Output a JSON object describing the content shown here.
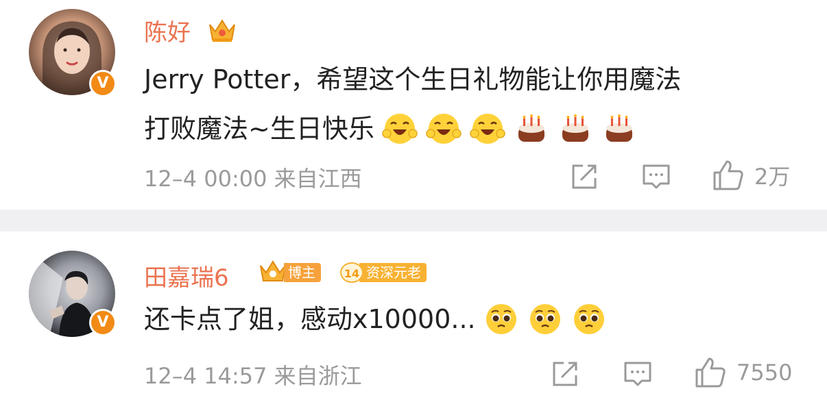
{
  "posts": [
    {
      "username": "陈好",
      "content_line1": "Jerry Potter，希望这个生日礼物能让你用魔法",
      "content_line2": "打败魔法~生日快乐",
      "meta": "12–4 00:00  来自江西",
      "likes": "2万",
      "verified_badge": "V"
    },
    {
      "username": "田嘉瑞6",
      "tag_blogger": "博主",
      "tag_senior_num": "14",
      "tag_senior": "资深元老",
      "content": "还卡点了姐，感动x10000...",
      "meta": "12–4 14:57  来自浙江",
      "likes": "7550",
      "verified_badge": "V"
    }
  ],
  "colors": {
    "username": "#eb7350",
    "meta": "#9a9a9a",
    "divider": "#f0f0f2",
    "verified": "#f28a16"
  },
  "icons": [
    "repost-icon",
    "comment-icon",
    "like-icon",
    "crown-icon",
    "laugh-emoji",
    "cake-emoji",
    "pleading-emoji"
  ]
}
